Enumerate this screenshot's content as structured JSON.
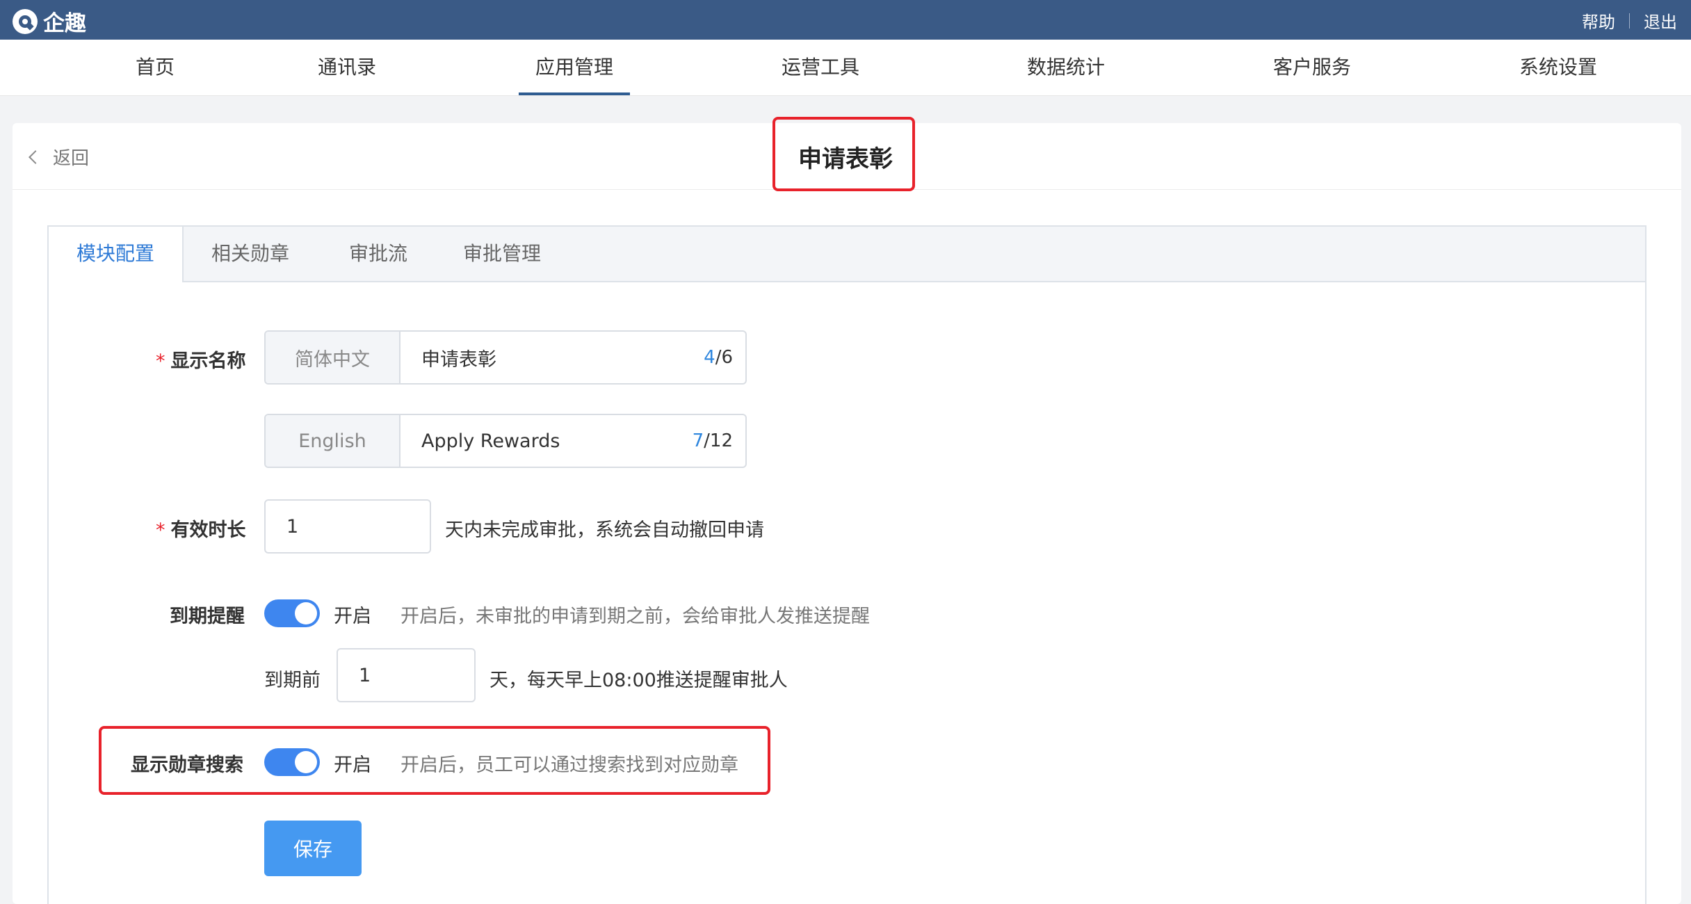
{
  "app": {
    "name": "企趣"
  },
  "top_links": {
    "help": "帮助",
    "logout": "退出"
  },
  "nav": {
    "items": [
      {
        "label": "首页"
      },
      {
        "label": "通讯录"
      },
      {
        "label": "应用管理",
        "active": true
      },
      {
        "label": "运营工具"
      },
      {
        "label": "数据统计"
      },
      {
        "label": "客户服务"
      },
      {
        "label": "系统设置"
      }
    ]
  },
  "header": {
    "back": "返回",
    "title": "申请表彰"
  },
  "tabs": [
    {
      "label": "模块配置",
      "active": true
    },
    {
      "label": "相关勋章"
    },
    {
      "label": "审批流"
    },
    {
      "label": "审批管理"
    }
  ],
  "form": {
    "display_name": {
      "label": "显示名称",
      "required": "*",
      "zh": {
        "lang": "简体中文",
        "value": "申请表彰",
        "count": "4",
        "max": "/6"
      },
      "en": {
        "lang": "English",
        "value": "Apply Rewards",
        "count": "7",
        "max": "/12"
      }
    },
    "validity": {
      "label": "有效时长",
      "required": "*",
      "value": "1",
      "suffix": "天内未完成审批，系统会自动撤回申请"
    },
    "expiry_reminder": {
      "label": "到期提醒",
      "enabled": true,
      "state_text": "开启",
      "hint": "开启后，未审批的申请到期之前，会给审批人发推送提醒",
      "before_label": "到期前",
      "before_value": "1",
      "before_suffix": "天，每天早上08:00推送提醒审批人"
    },
    "medal_search": {
      "label": "显示勋章搜索",
      "enabled": true,
      "state_text": "开启",
      "hint": "开启后，员工可以通过搜索找到对应勋章"
    },
    "save_label": "保存"
  },
  "colors": {
    "topbar": "#3a5a86",
    "accent": "#2e7ad6",
    "toggle_on": "#3e86ef",
    "button": "#4599f1",
    "highlight": "#e8222b"
  }
}
